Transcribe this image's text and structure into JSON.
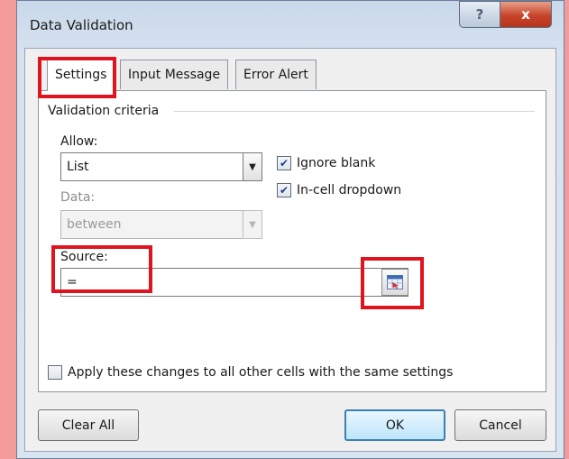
{
  "dialog": {
    "title": "Data Validation",
    "help_label": "?",
    "close_label": "x"
  },
  "tabs": [
    {
      "label": "Settings",
      "active": true
    },
    {
      "label": "Input Message",
      "active": false
    },
    {
      "label": "Error Alert",
      "active": false
    }
  ],
  "settings": {
    "group_label": "Validation criteria",
    "allow_label": "Allow:",
    "allow_value": "List",
    "data_label": "Data:",
    "data_value": "between",
    "ignore_blank_label": "Ignore blank",
    "ignore_blank_checked": true,
    "in_cell_dropdown_label": "In-cell dropdown",
    "in_cell_dropdown_checked": true,
    "source_label": "Source:",
    "source_value": "=",
    "apply_all_label": "Apply these changes to all other cells with the same settings",
    "apply_all_checked": false
  },
  "buttons": {
    "clear_all": "Clear All",
    "ok": "OK",
    "cancel": "Cancel"
  },
  "colors": {
    "highlight": "#e0141e",
    "close_button": "#c7442a",
    "check_mark": "#1e3f8a"
  }
}
